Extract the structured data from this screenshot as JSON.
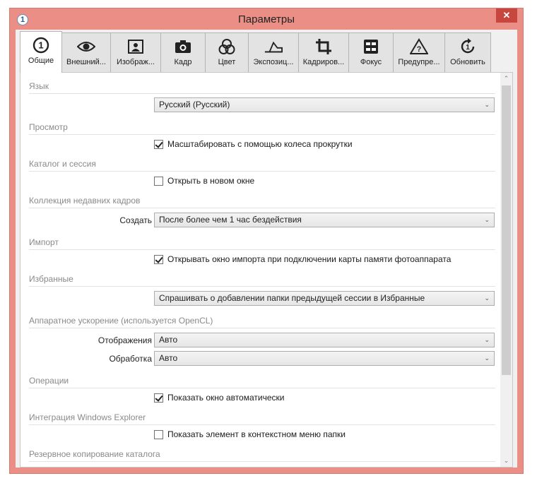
{
  "window": {
    "title": "Параметры",
    "close_glyph": "✕",
    "app_icon_glyph": "1"
  },
  "tabs": [
    {
      "label": "Общие",
      "icon": "general-icon",
      "active": true
    },
    {
      "label": "Внешний...",
      "icon": "eye-icon"
    },
    {
      "label": "Изображ...",
      "icon": "image-icon"
    },
    {
      "label": "Кадр",
      "icon": "camera-icon"
    },
    {
      "label": "Цвет",
      "icon": "color-circles-icon"
    },
    {
      "label": "Экспозиц...",
      "icon": "exposure-icon"
    },
    {
      "label": "Кадриров...",
      "icon": "crop-icon"
    },
    {
      "label": "Фокус",
      "icon": "focus-icon"
    },
    {
      "label": "Предупре...",
      "icon": "warning-icon"
    },
    {
      "label": "Обновить",
      "icon": "update-icon"
    }
  ],
  "sections": {
    "language": {
      "header": "Язык",
      "dropdown_value": "Русский (Русский)"
    },
    "preview": {
      "header": "Просмотр",
      "checkbox_label": "Масштабировать с помощью колеса прокрутки",
      "checked": true
    },
    "catalog": {
      "header": "Каталог и сессия",
      "checkbox_label": "Открыть в новом окне",
      "checked": false
    },
    "recent": {
      "header": "Коллекция недавних кадров",
      "field_label": "Создать",
      "dropdown_value": "После более чем 1 час бездействия"
    },
    "import": {
      "header": "Импорт",
      "checkbox_label": "Открывать окно импорта при подключении карты памяти фотоаппарата",
      "checked": true
    },
    "favorites": {
      "header": "Избранные",
      "dropdown_value": "Спрашивать о добавлении папки предыдущей сессии в Избранные"
    },
    "hardware": {
      "header": "Аппаратное ускорение (используется OpenCL)",
      "display_label": "Отображения",
      "display_value": "Авто",
      "processing_label": "Обработка",
      "processing_value": "Авто"
    },
    "operations": {
      "header": "Операции",
      "checkbox_label": "Показать окно автоматически",
      "checked": true
    },
    "explorer": {
      "header": "Интеграция Windows Explorer",
      "checkbox_label": "Показать элемент в контекстном меню папки",
      "checked": false
    },
    "backup": {
      "header": "Резервное копирование каталога"
    }
  },
  "colors": {
    "window_frame": "#eb8f86",
    "close_button": "#c7463d"
  }
}
